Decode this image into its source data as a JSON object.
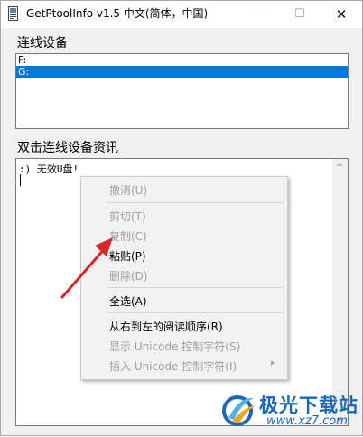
{
  "window": {
    "title": "GetPtoolInfo v1.5 中文(简体，中国)",
    "close_glyph": "✕",
    "minimize_glyph": "—",
    "maximize_glyph": "☐"
  },
  "devices_group": {
    "label": "连线设备",
    "items": [
      {
        "label": "F:",
        "selected": false
      },
      {
        "label": "G:",
        "selected": true
      }
    ]
  },
  "info_group": {
    "label": "双击连线设备资讯",
    "text": ":) 无效U盘!"
  },
  "context_menu": {
    "items": [
      {
        "label": "撤消(U)",
        "enabled": false
      },
      {
        "label": "剪切(T)",
        "enabled": false
      },
      {
        "label": "复制(C)",
        "enabled": false
      },
      {
        "label": "粘贴(P)",
        "enabled": true
      },
      {
        "label": "删除(D)",
        "enabled": false
      },
      {
        "label": "全选(A)",
        "enabled": true
      },
      {
        "label": "从右到左的阅读顺序(R)",
        "enabled": true
      },
      {
        "label": "显示 Unicode 控制字符(S)",
        "enabled": false
      },
      {
        "label": "插入 Unicode 控制字符(I)",
        "enabled": false
      }
    ]
  },
  "watermark": {
    "name": "极光下载站",
    "url": "www.xz7.com"
  },
  "colors": {
    "selection": "#0078d7",
    "disabled_text": "#a0a0a0",
    "annotation_arrow": "#d9262b",
    "watermark_blue": "#1c66b8"
  },
  "icons": {
    "app": "app-window-icon",
    "annotation": "red-arrow-icon",
    "watermark_logo": "aurora-logo-icon"
  }
}
